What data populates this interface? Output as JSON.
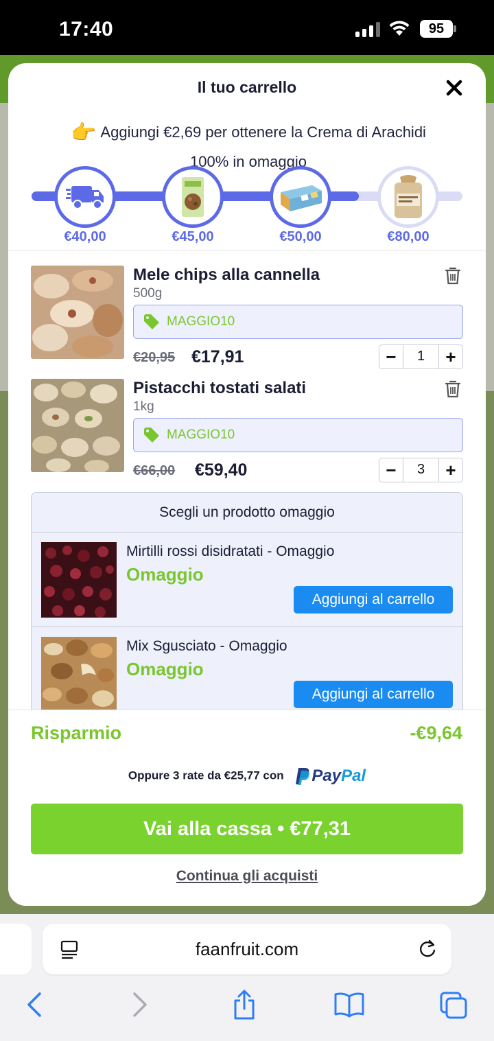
{
  "status_bar": {
    "time": "17:40",
    "battery": "95"
  },
  "cart": {
    "title": "Il tuo carrello",
    "promo_line1": "Aggiungi €2,69 per ottenere la Crema di Arachidi",
    "promo_line2": "100% in omaggio",
    "progress_fraction": 0.76,
    "milestones": [
      {
        "label": "€40,00",
        "icon": "truck-icon",
        "reached": true
      },
      {
        "label": "€45,00",
        "icon": "granola-bag-icon",
        "reached": true
      },
      {
        "label": "€50,00",
        "icon": "gift-box-icon",
        "reached": true
      },
      {
        "label": "€80,00",
        "icon": "peanut-butter-jar-icon",
        "reached": false
      }
    ],
    "items": [
      {
        "name": "Mele chips alla cannella",
        "weight": "500g",
        "coupon": "MAGGIO10",
        "old_price": "€20,95",
        "price": "€17,91",
        "qty": "1"
      },
      {
        "name": "Pistacchi tostati salati",
        "weight": "1kg",
        "coupon": "MAGGIO10",
        "old_price": "€66,00",
        "price": "€59,40",
        "qty": "3"
      }
    ],
    "gift": {
      "heading": "Scegli un prodotto omaggio",
      "items": [
        {
          "name": "Mirtilli rossi disidratati - Omaggio",
          "tag": "Omaggio",
          "button": "Aggiungi al carrello"
        },
        {
          "name": "Mix Sgusciato - Omaggio",
          "tag": "Omaggio",
          "button": "Aggiungi al carrello"
        }
      ]
    },
    "saving_label": "Risparmio",
    "saving_value": "-€9,64",
    "paypal_text": "Oppure 3 rate da €25,77 con",
    "paypal_brand_1": "Pay",
    "paypal_brand_2": "Pal",
    "checkout_label": "Vai alla cassa • €77,31",
    "continue_label": "Continua gli acquisti"
  },
  "browser": {
    "url": "faanfruit.com"
  },
  "colors": {
    "accent": "#5d6ae8",
    "green": "#7ac62e",
    "blue_button": "#1a8bf0"
  }
}
